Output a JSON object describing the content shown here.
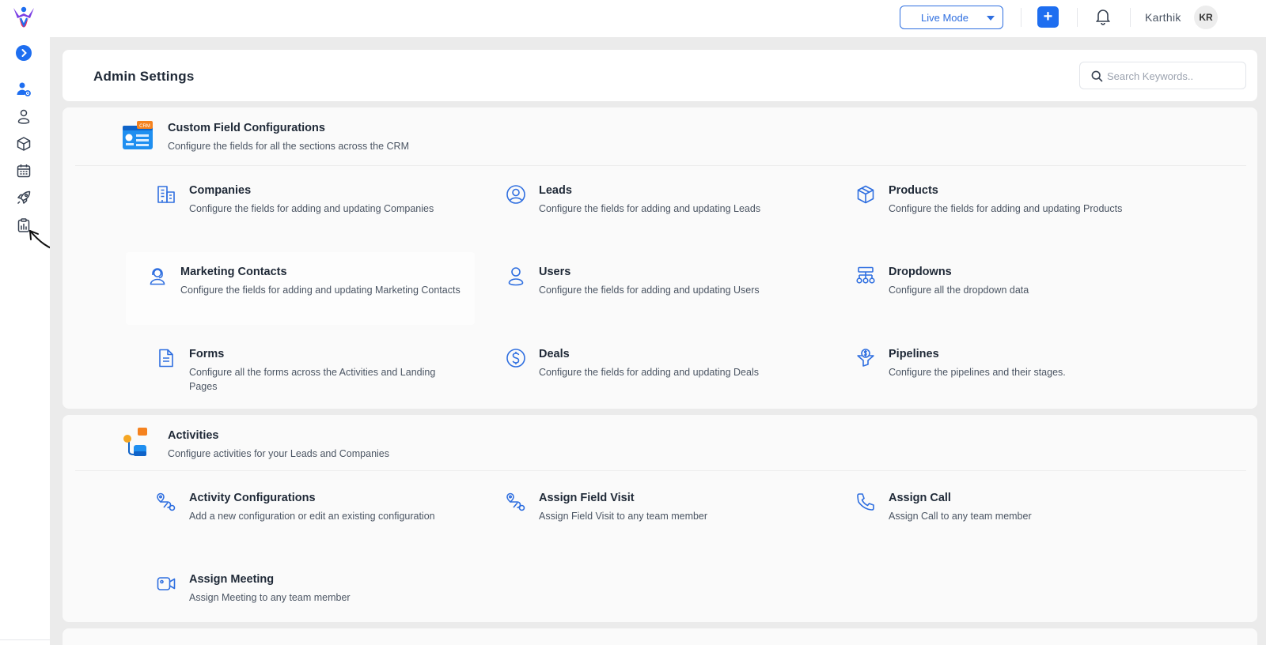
{
  "topbar": {
    "mode_label": "Live Mode",
    "plus_label": "+",
    "user_name": "Karthik",
    "user_initials": "KR"
  },
  "sidebar": {
    "items": [
      {
        "name": "admin-settings",
        "icon": "user-gear-icon"
      },
      {
        "name": "users",
        "icon": "user-icon"
      },
      {
        "name": "products",
        "icon": "box-icon"
      },
      {
        "name": "calendar",
        "icon": "calendar-icon"
      },
      {
        "name": "marketing",
        "icon": "rocket-icon"
      },
      {
        "name": "reports",
        "icon": "clipboard-chart-icon"
      }
    ]
  },
  "header": {
    "title": "Admin Settings",
    "search_placeholder": "Search Keywords.."
  },
  "custom_fields": {
    "title": "Custom Field Configurations",
    "desc": "Configure the fields for all the sections across the CRM",
    "badge": "CRM",
    "items": [
      {
        "title": "Companies",
        "desc": "Configure the fields for adding and updating Companies",
        "icon": "building-icon"
      },
      {
        "title": "Leads",
        "desc": "Configure the fields for adding and updating Leads",
        "icon": "user-circle-icon"
      },
      {
        "title": "Products",
        "desc": "Configure the fields for adding and updating Products",
        "icon": "box-icon"
      },
      {
        "title": "Marketing Contacts",
        "desc": "Configure the fields for adding and updating Marketing Contacts",
        "icon": "headset-icon"
      },
      {
        "title": "Users",
        "desc": "Configure the fields for adding and updating Users",
        "icon": "user-icon"
      },
      {
        "title": "Dropdowns",
        "desc": "Configure all the dropdown data",
        "icon": "hierarchy-icon"
      },
      {
        "title": "Forms",
        "desc": "Configure all the forms across the Activities and Landing Pages",
        "icon": "document-icon"
      },
      {
        "title": "Deals",
        "desc": "Configure the fields for adding and updating Deals",
        "icon": "dollar-circle-icon"
      },
      {
        "title": "Pipelines",
        "desc": "Configure the pipelines and their stages.",
        "icon": "funnel-icon"
      }
    ]
  },
  "activities": {
    "title": "Activities",
    "desc": "Configure activities for your Leads and Companies",
    "items": [
      {
        "title": "Activity Configurations",
        "desc": "Add a new configuration or edit an existing configuration",
        "icon": "route-icon"
      },
      {
        "title": "Assign Field Visit",
        "desc": "Assign Field Visit to any team member",
        "icon": "route-icon"
      },
      {
        "title": "Assign Call",
        "desc": "Assign Call to any team member",
        "icon": "phone-icon"
      },
      {
        "title": "Assign Meeting",
        "desc": "Assign Meeting to any team member",
        "icon": "video-icon"
      }
    ]
  },
  "colors": {
    "accent": "#1e6ef0",
    "icon_blue": "#2f6fe0",
    "background": "#ebebeb"
  }
}
